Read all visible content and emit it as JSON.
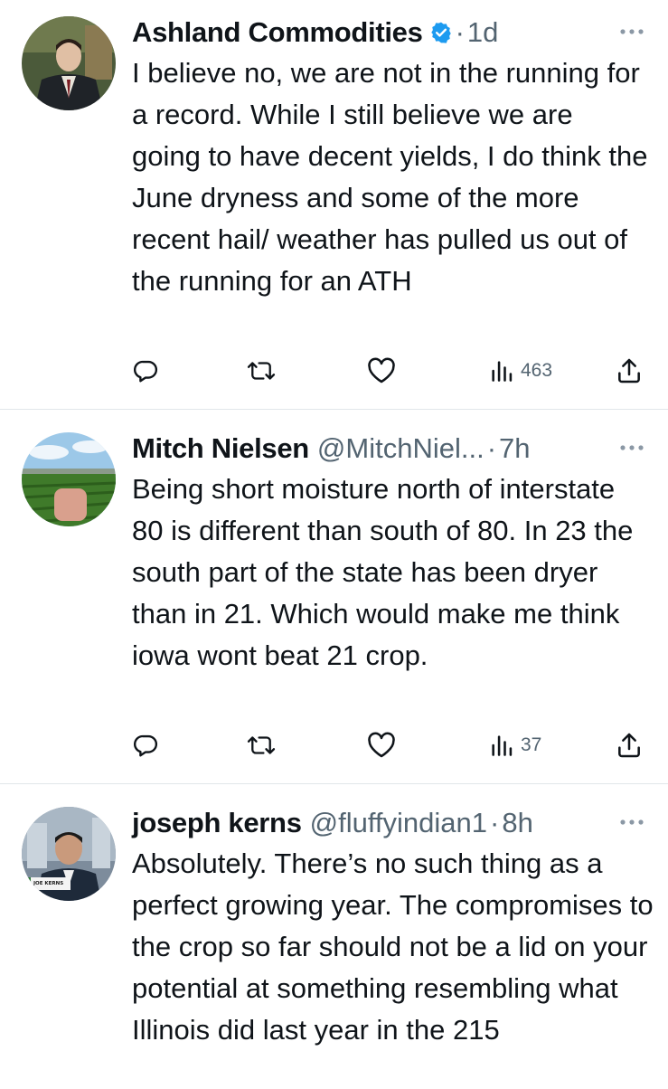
{
  "colors": {
    "text": "#0f1419",
    "secondary": "#536471",
    "verified_blue": "#1d9bf0",
    "divider": "#e1e6ea"
  },
  "tweets": [
    {
      "name": "Ashland Commodities",
      "verified": true,
      "handle": "",
      "dot": "·",
      "time": "1d",
      "text": "I believe no, we are not in the running for a record. While I still believe we are going to have decent yields, I do think the June dryness and some of the more recent hail/ weather has pulled us out of the running for an ATH",
      "views": "463",
      "icons": [
        "reply-icon",
        "retweet-icon",
        "like-icon",
        "views-icon",
        "share-icon",
        "more-icon"
      ]
    },
    {
      "name": "Mitch Nielsen",
      "verified": false,
      "handle": "@MitchNiel...",
      "dot": "·",
      "time": "7h",
      "text": "Being short moisture north of interstate 80 is different than south of 80. In 23 the south part of the state has been dryer than in 21. Which would make me think iowa wont beat 21 crop.",
      "views": "37",
      "icons": [
        "reply-icon",
        "retweet-icon",
        "like-icon",
        "views-icon",
        "share-icon",
        "more-icon"
      ]
    },
    {
      "name": "joseph kerns",
      "verified": false,
      "handle": "@fluffyindian1",
      "dot": "·",
      "time": "8h",
      "text": "Absolutely. There’s no such thing as a perfect growing year. The compromises to the crop so far should not be a lid on your potential at something resembling what Illinois did last year in the 215",
      "avatar_caption": "JOE KERNS",
      "icons": [
        "more-icon"
      ]
    }
  ]
}
